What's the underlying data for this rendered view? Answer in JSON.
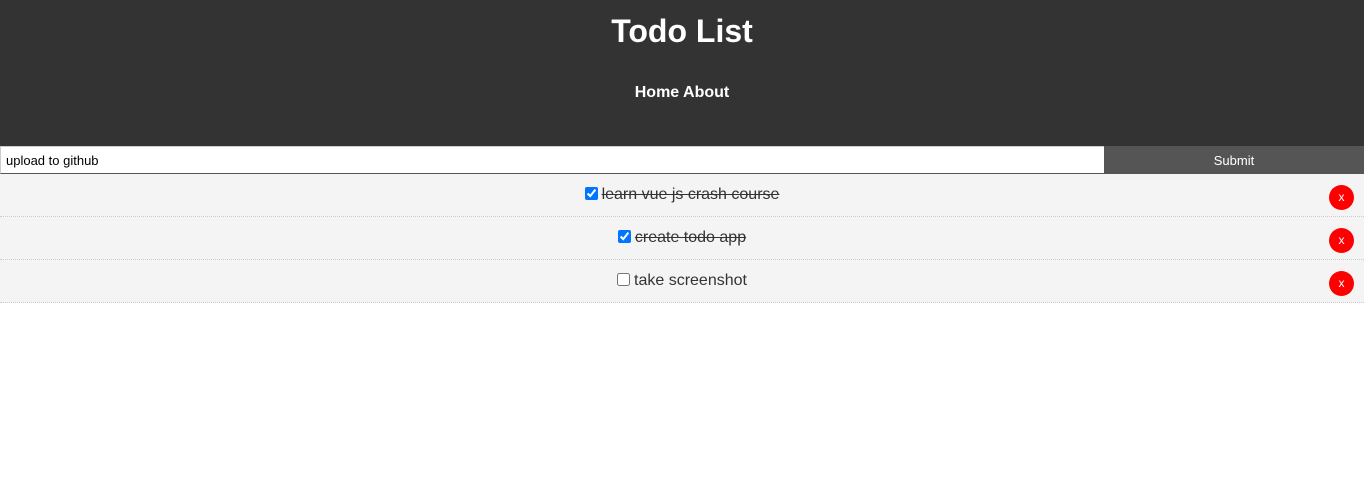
{
  "header": {
    "title": "Todo List",
    "nav": [
      {
        "label": "Home"
      },
      {
        "label": "About"
      }
    ]
  },
  "form": {
    "input_value": "upload to github",
    "submit_label": "Submit"
  },
  "todos": [
    {
      "title": "learn vue js crash course",
      "completed": true,
      "delete_label": "x"
    },
    {
      "title": "create todo app",
      "completed": true,
      "delete_label": "x"
    },
    {
      "title": "take screenshot",
      "completed": false,
      "delete_label": "x"
    }
  ],
  "colors": {
    "header_bg": "#333333",
    "item_bg": "#f4f4f4",
    "submit_bg": "#555555",
    "delete_bg": "#ff0000"
  }
}
